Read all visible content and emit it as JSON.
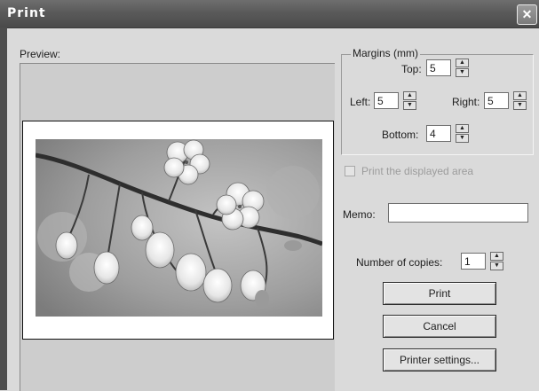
{
  "window": {
    "title": "Print",
    "close_glyph": "✕"
  },
  "preview": {
    "label": "Preview:"
  },
  "margins": {
    "legend": "Margins (mm)",
    "top_label": "Top:",
    "top_value": "5",
    "left_label": "Left:",
    "left_value": "5",
    "right_label": "Right:",
    "right_value": "5",
    "bottom_label": "Bottom:",
    "bottom_value": "4"
  },
  "print_displayed_area": {
    "label": "Print the displayed area",
    "checked": false,
    "enabled": false
  },
  "memo": {
    "label": "Memo:",
    "value": ""
  },
  "copies": {
    "label": "Number of copies:",
    "value": "1"
  },
  "buttons": {
    "print": "Print",
    "cancel": "Cancel",
    "printer_settings": "Printer settings..."
  },
  "icons": {
    "spin_up": "▲",
    "spin_down": "▼"
  }
}
